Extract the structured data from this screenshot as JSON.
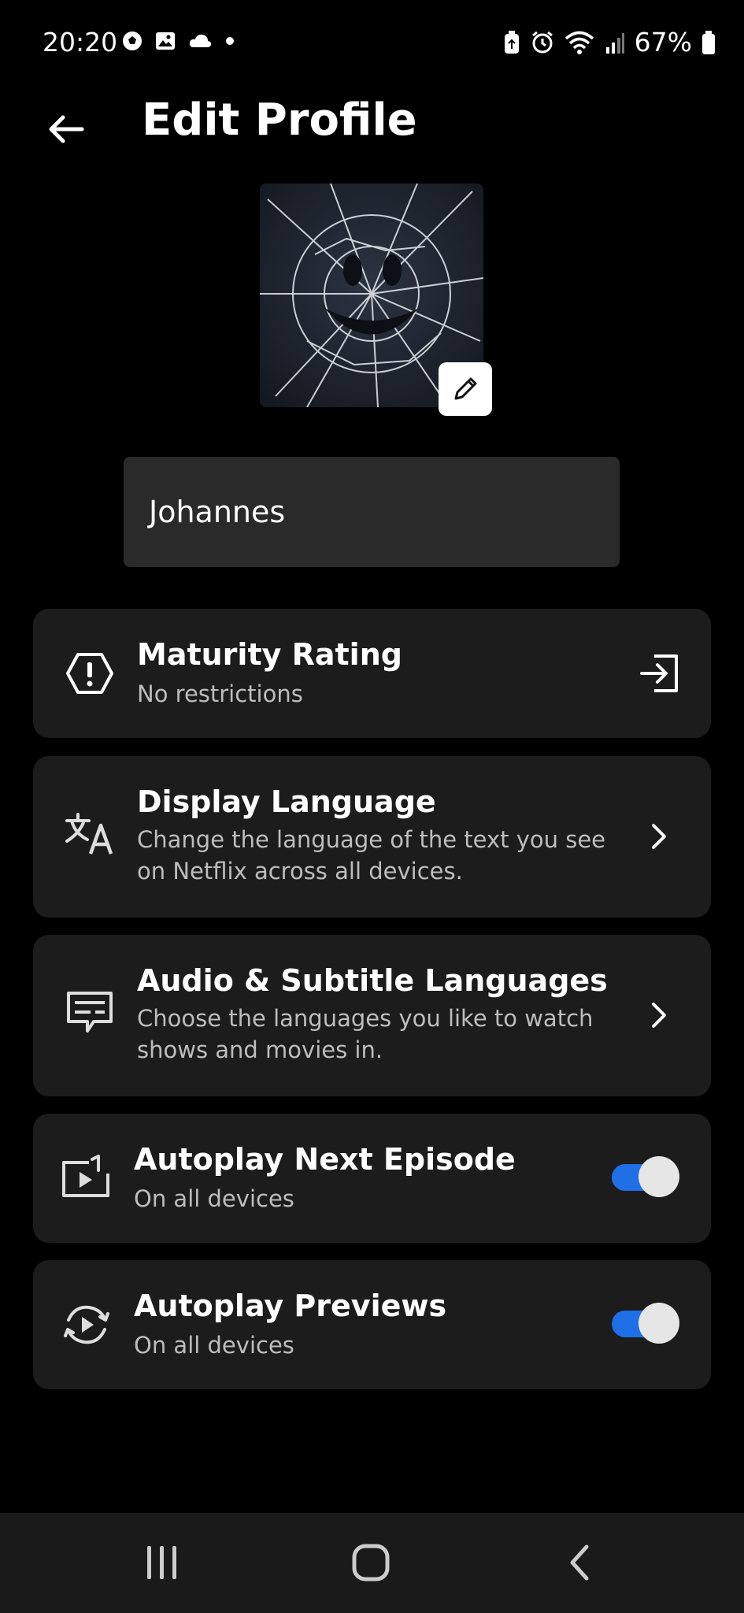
{
  "status_bar": {
    "time": "20:20",
    "battery": "67%",
    "left_icons": [
      "soccer-ball-icon",
      "image-icon",
      "cloud-icon",
      "dot-icon"
    ],
    "right_icons": [
      "battery-saver-icon",
      "alarm-icon",
      "wifi-icon",
      "signal-icon",
      "battery-icon"
    ]
  },
  "header": {
    "title": "Edit Profile"
  },
  "profile": {
    "name": "Johannes"
  },
  "settings": [
    {
      "title": "Maturity Rating",
      "subtitle": "No restrictions",
      "icon": "warning-hexagon-icon",
      "trailing": "exit-icon"
    },
    {
      "title": "Display Language",
      "subtitle": "Change the language of the text you see on Netflix across all devices.",
      "icon": "translate-icon",
      "trailing": "chevron-right-icon"
    },
    {
      "title": "Audio & Subtitle Languages",
      "subtitle": "Choose the languages you like to watch shows and movies in.",
      "icon": "subtitles-icon",
      "trailing": "chevron-right-icon"
    },
    {
      "title": "Autoplay Next Episode",
      "subtitle": "On all devices",
      "icon": "autoplay-next-icon",
      "toggle_on": true
    },
    {
      "title": "Autoplay Previews",
      "subtitle": "On all devices",
      "icon": "autoplay-previews-icon",
      "toggle_on": true
    }
  ],
  "colors": {
    "toggle_on": "#1f6fe6",
    "card_bg": "#1c1c1c",
    "field_bg": "#2a2a2a"
  }
}
